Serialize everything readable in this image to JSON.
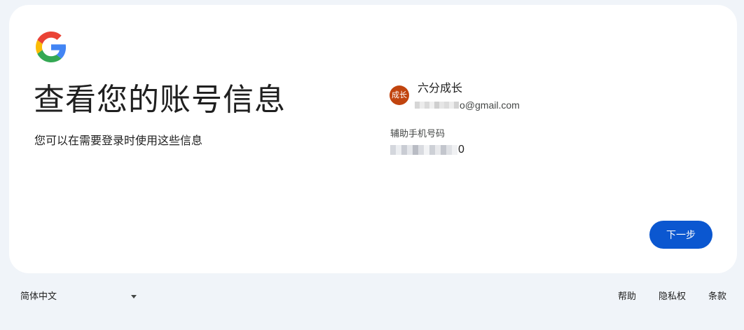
{
  "brand": {
    "logo_icon": "google-g-logo-icon",
    "colors": {
      "blue": "#4285F4",
      "red": "#EA4335",
      "yellow": "#FBBC05",
      "green": "#34A853"
    }
  },
  "page": {
    "title": "查看您的账号信息",
    "subtitle": "您可以在需要登录时使用这些信息"
  },
  "account": {
    "avatar_text": "成长",
    "avatar_color": "#c1440e",
    "name": "六分成长",
    "email_visible_suffix": "o@gmail.com",
    "recovery_phone_label": "辅助手机号码",
    "recovery_phone_visible_suffix": "0"
  },
  "actions": {
    "next_label": "下一步",
    "accent": "#0b57d0"
  },
  "footer": {
    "language": "简体中文",
    "links": [
      "帮助",
      "隐私权",
      "条款"
    ]
  }
}
